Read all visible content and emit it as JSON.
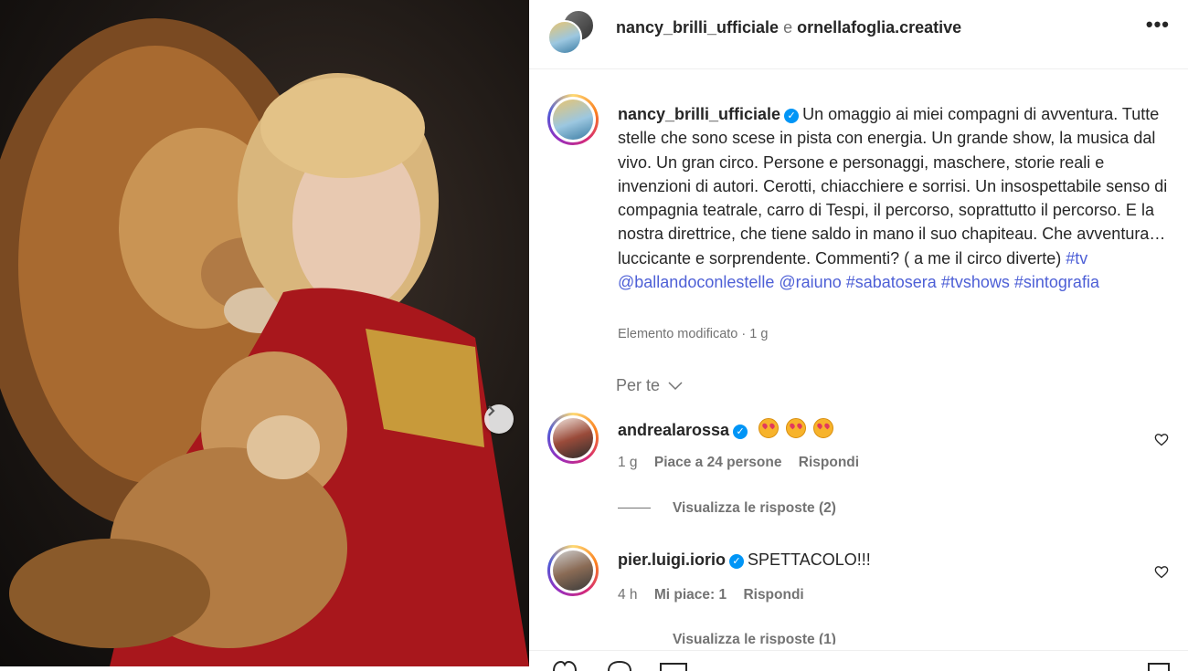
{
  "post": {
    "header": {
      "author": "nancy_brilli_ufficiale",
      "conjunction": "e",
      "coauthor": "ornellafoglia.creative",
      "more_label": "•••"
    },
    "caption": {
      "username": "nancy_brilli_ufficiale",
      "text": "Un omaggio ai miei compagni di avventura. Tutte stelle che sono scese in pista con energia. Un grande show, la musica dal vivo. Un gran circo. Persone e personaggi, maschere, storie reali e invenzioni di autori. Cerotti, chiacchiere e sorrisi. Un insospettabile senso di compagnia teatrale, carro di Tespi, il percorso, soprattutto il percorso. E la nostra direttrice, che tiene saldo in mano il suo chapiteau. Che avventura… luccicante e sorprendente. Commenti? ( a me il circo diverte)",
      "tags": [
        "#tv",
        "@ballandoconlestelle",
        "@raiuno",
        "#sabatosera",
        "#tvshows",
        "#sintografia"
      ],
      "edited_note": "Elemento modificato · 1 g"
    },
    "sort_label": "Per te",
    "comments": [
      {
        "username": "andrealarossa",
        "text": "",
        "time": "1 g",
        "likes": "Piace a 24 persone",
        "reply": "Rispondi",
        "view_replies": "Visualizza le risposte (2)"
      },
      {
        "username": "pier.luigi.iorio",
        "text": "SPETTACOLO!!!",
        "time": "4 h",
        "likes": "Mi piace: 1",
        "reply": "Rispondi",
        "view_replies": "Visualizza le risposte (1)"
      }
    ]
  },
  "icons": {
    "verified": "verified-badge-icon",
    "next": "chevron-right-icon",
    "heart": "heart-outline-icon",
    "chevron": "chevron-down-icon"
  },
  "colors": {
    "verified": "#0095f6",
    "link": "#4d5fd6",
    "muted": "#737373"
  }
}
